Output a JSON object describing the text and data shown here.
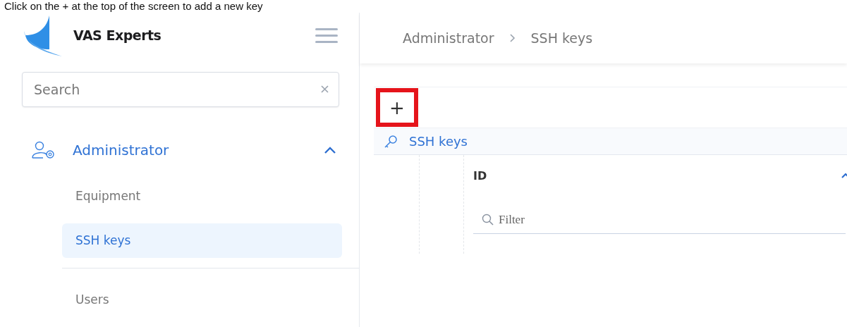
{
  "caption": "Click on the + at the top of the screen to add a new key",
  "brand": {
    "name": "VAS Experts"
  },
  "sidebar": {
    "search": {
      "placeholder": "Search"
    },
    "items": [
      {
        "label": "Administrator",
        "expanded": true,
        "children": [
          {
            "label": "Equipment",
            "selected": false
          },
          {
            "label": "SSH keys",
            "selected": true
          },
          {
            "label": "Users",
            "selected": false
          }
        ]
      }
    ]
  },
  "breadcrumb": [
    "Administrator",
    "SSH keys"
  ],
  "toolbar": {
    "add_button": {
      "label": "+",
      "highlighted": true
    }
  },
  "grid": {
    "title": "SSH keys",
    "columns": [
      {
        "label": "ID",
        "sorted_ascending": true
      }
    ],
    "filter": {
      "placeholder": "Filter"
    }
  }
}
